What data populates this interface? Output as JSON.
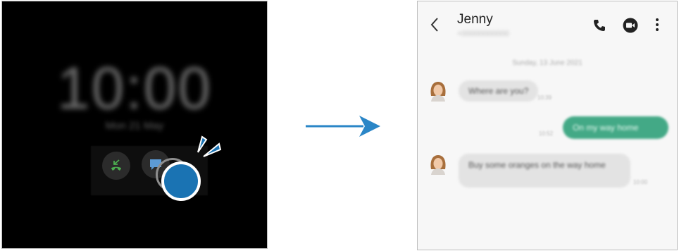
{
  "lock_screen": {
    "time": "10:00",
    "date": "Mon 21 May",
    "actions": [
      {
        "icon": "call-accept-icon",
        "color": "#4caf50"
      },
      {
        "icon": "message-icon",
        "color": "#5c9bd6"
      }
    ],
    "tap_color": "#1a73b3"
  },
  "arrow_color": "#2a86c7",
  "chat": {
    "header": {
      "contact_name": "Jenny",
      "contact_number": "+00000000000"
    },
    "date_separator": "Sunday, 13 June 2021",
    "messages": [
      {
        "direction": "in",
        "text": "Where are you?",
        "time": "10:39"
      },
      {
        "direction": "out",
        "text": "On my way home",
        "time": "10:52"
      },
      {
        "direction": "in",
        "text": "Buy some oranges on the way home",
        "time": "10:00"
      }
    ],
    "colors": {
      "incoming_bubble": "#e3e3e3",
      "outgoing_bubble": "#43a986"
    }
  }
}
